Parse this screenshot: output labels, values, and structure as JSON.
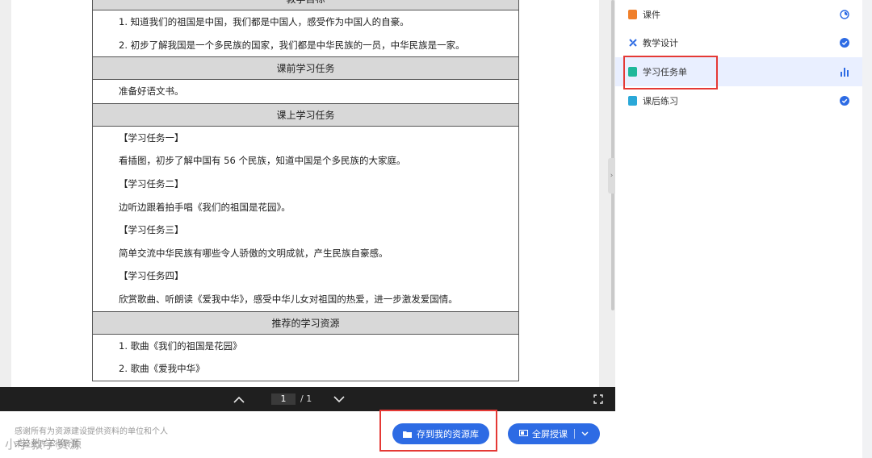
{
  "document": {
    "section_top_partial": "教学目标",
    "goals": [
      "1. 知道我们的祖国是中国，我们都是中国人，感受作为中国人的自豪。",
      "2. 初步了解我国是一个多民族的国家，我们都是中华民族的一员，中华民族是一家。"
    ],
    "pre_class_title": "课前学习任务",
    "pre_class_text": "准备好语文书。",
    "in_class_title": "课上学习任务",
    "tasks": [
      "【学习任务一】",
      "看插图，初步了解中国有 56 个民族，知道中国是个多民族的大家庭。",
      "【学习任务二】",
      "边听边跟着拍手唱《我们的祖国是花园》。",
      "【学习任务三】",
      "简单交流中华民族有哪些令人骄傲的文明成就，产生民族自豪感。",
      "【学习任务四】",
      "欣赏歌曲、听朗读《爱我中华》，感受中华儿女对祖国的热爱，进一步激发爱国情。"
    ],
    "resources_title": "推荐的学习资源",
    "resources": [
      "1. 歌曲《我们的祖国是花园》",
      "2. 歌曲《爱我中华》"
    ]
  },
  "toolbar": {
    "page_current": "1",
    "page_total": "/ 1",
    "prev_icon": "chevron-up-icon",
    "next_icon": "chevron-down-icon",
    "fullscreen_icon": "fullscreen-icon"
  },
  "footer": {
    "notice_line1": "感谢所有为资源建设提供资料的单位和个人",
    "notice_line2": "未经允许不得转载",
    "watermark": "小学教学资源",
    "save_button": "存到我的资源库",
    "fullscreen_button": "全屏授课"
  },
  "sidebar": {
    "items": [
      {
        "label": "课件",
        "icon": "ppt-icon",
        "status": "progress-icon",
        "color": "#f07f2a"
      },
      {
        "label": "教学设计",
        "icon": "design-icon",
        "status": "check-icon",
        "color": "#2d6be4"
      },
      {
        "label": "学习任务单",
        "icon": "task-sheet-icon",
        "status": "bar-chart-icon",
        "color": "#1fb89a"
      },
      {
        "label": "课后练习",
        "icon": "exercise-icon",
        "status": "check-icon",
        "color": "#2aa8d8"
      }
    ]
  },
  "colors": {
    "accent": "#2d6be4",
    "highlight": "#e53935",
    "toolbar": "#1f1f1f",
    "active_bg": "#e9efff"
  }
}
